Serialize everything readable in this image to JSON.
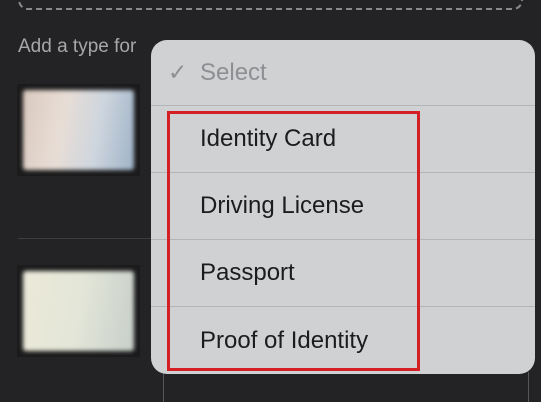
{
  "form": {
    "add_type_label": "Add a type for"
  },
  "menu": {
    "check_glyph": "✓",
    "selected_label": "Select",
    "options": [
      {
        "label": "Identity Card"
      },
      {
        "label": "Driving License"
      },
      {
        "label": "Passport"
      },
      {
        "label": "Proof of Identity"
      }
    ]
  },
  "colors": {
    "background": "#232325",
    "menu_background": "#d0d1d3",
    "highlight_border": "#d42024"
  }
}
